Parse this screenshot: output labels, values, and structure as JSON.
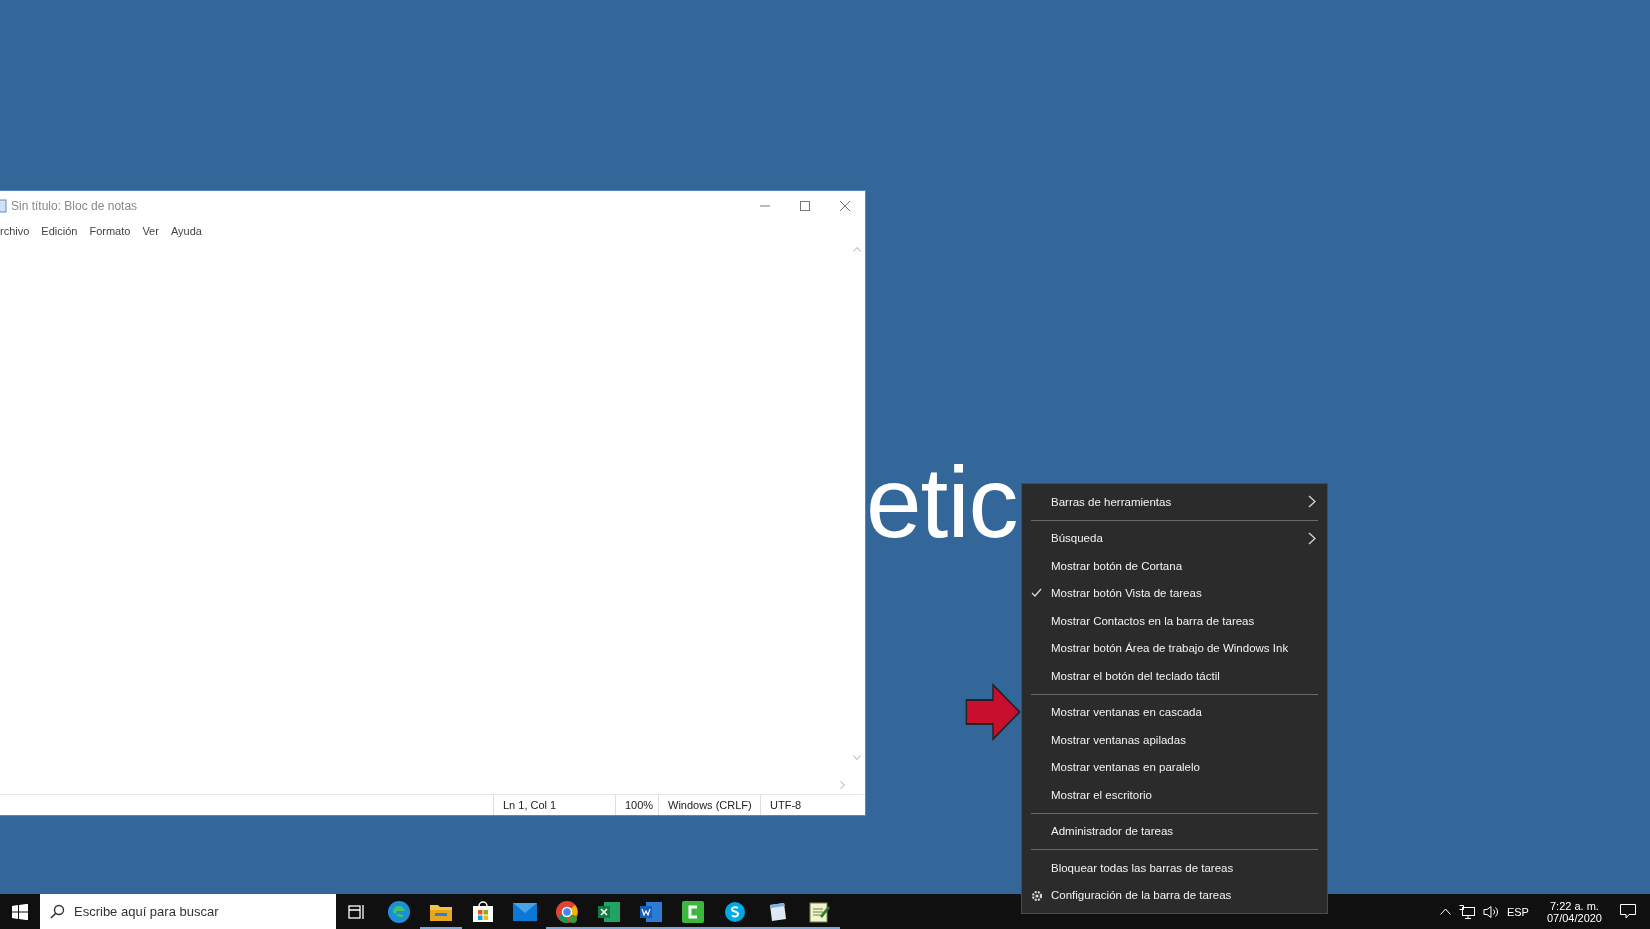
{
  "desktop": {
    "wallpaper_text": "etic"
  },
  "notepad": {
    "title": "Sin título: Bloc de notas",
    "menu": [
      "rchivo",
      "Edición",
      "Formato",
      "Ver",
      "Ayuda"
    ],
    "status": [
      "Ln 1, Col 1",
      "100%",
      "Windows (CRLF)",
      "UTF-8"
    ]
  },
  "context_menu": {
    "groups": [
      [
        {
          "label": "Barras de herramientas",
          "kind": "submenu",
          "checked": false
        }
      ],
      [
        {
          "label": "Búsqueda",
          "kind": "submenu",
          "checked": false
        },
        {
          "label": "Mostrar botón de Cortana",
          "kind": "option",
          "checked": false
        },
        {
          "label": "Mostrar botón Vista de tareas",
          "kind": "option",
          "checked": true
        },
        {
          "label": "Mostrar Contactos en la barra de tareas",
          "kind": "option",
          "checked": false
        },
        {
          "label": "Mostrar botón Área de trabajo de Windows Ink",
          "kind": "option",
          "checked": false
        },
        {
          "label": "Mostrar el botón del teclado táctil",
          "kind": "option",
          "checked": false
        }
      ],
      [
        {
          "label": "Mostrar ventanas en cascada",
          "kind": "command",
          "checked": false
        },
        {
          "label": "Mostrar ventanas apiladas",
          "kind": "command",
          "checked": false
        },
        {
          "label": "Mostrar ventanas en paralelo",
          "kind": "command",
          "checked": false
        },
        {
          "label": "Mostrar el escritorio",
          "kind": "command",
          "checked": false
        }
      ],
      [
        {
          "label": "Administrador de tareas",
          "kind": "command",
          "checked": false
        }
      ],
      [
        {
          "label": "Bloquear todas las barras de tareas",
          "kind": "option",
          "checked": false
        },
        {
          "label": "Configuración de la barra de tareas",
          "kind": "settings",
          "checked": false
        }
      ]
    ]
  },
  "taskbar": {
    "search": {
      "placeholder": "Escribe aquí para buscar"
    },
    "apps": [
      {
        "kind": "taskview",
        "running": false
      },
      {
        "kind": "edge",
        "running": false
      },
      {
        "kind": "folder",
        "running": true
      },
      {
        "kind": "store",
        "running": false
      },
      {
        "kind": "mail",
        "running": false
      },
      {
        "kind": "chrome",
        "running": true
      },
      {
        "kind": "excel",
        "running": true
      },
      {
        "kind": "word",
        "running": true
      },
      {
        "kind": "camtasia",
        "running": true
      },
      {
        "kind": "skype",
        "running": true
      },
      {
        "kind": "pad",
        "running": true
      },
      {
        "kind": "notepad",
        "running": true
      }
    ],
    "tray": {
      "language": "ESP",
      "time": "7:22 a. m.",
      "date": "07/04/2020"
    }
  }
}
